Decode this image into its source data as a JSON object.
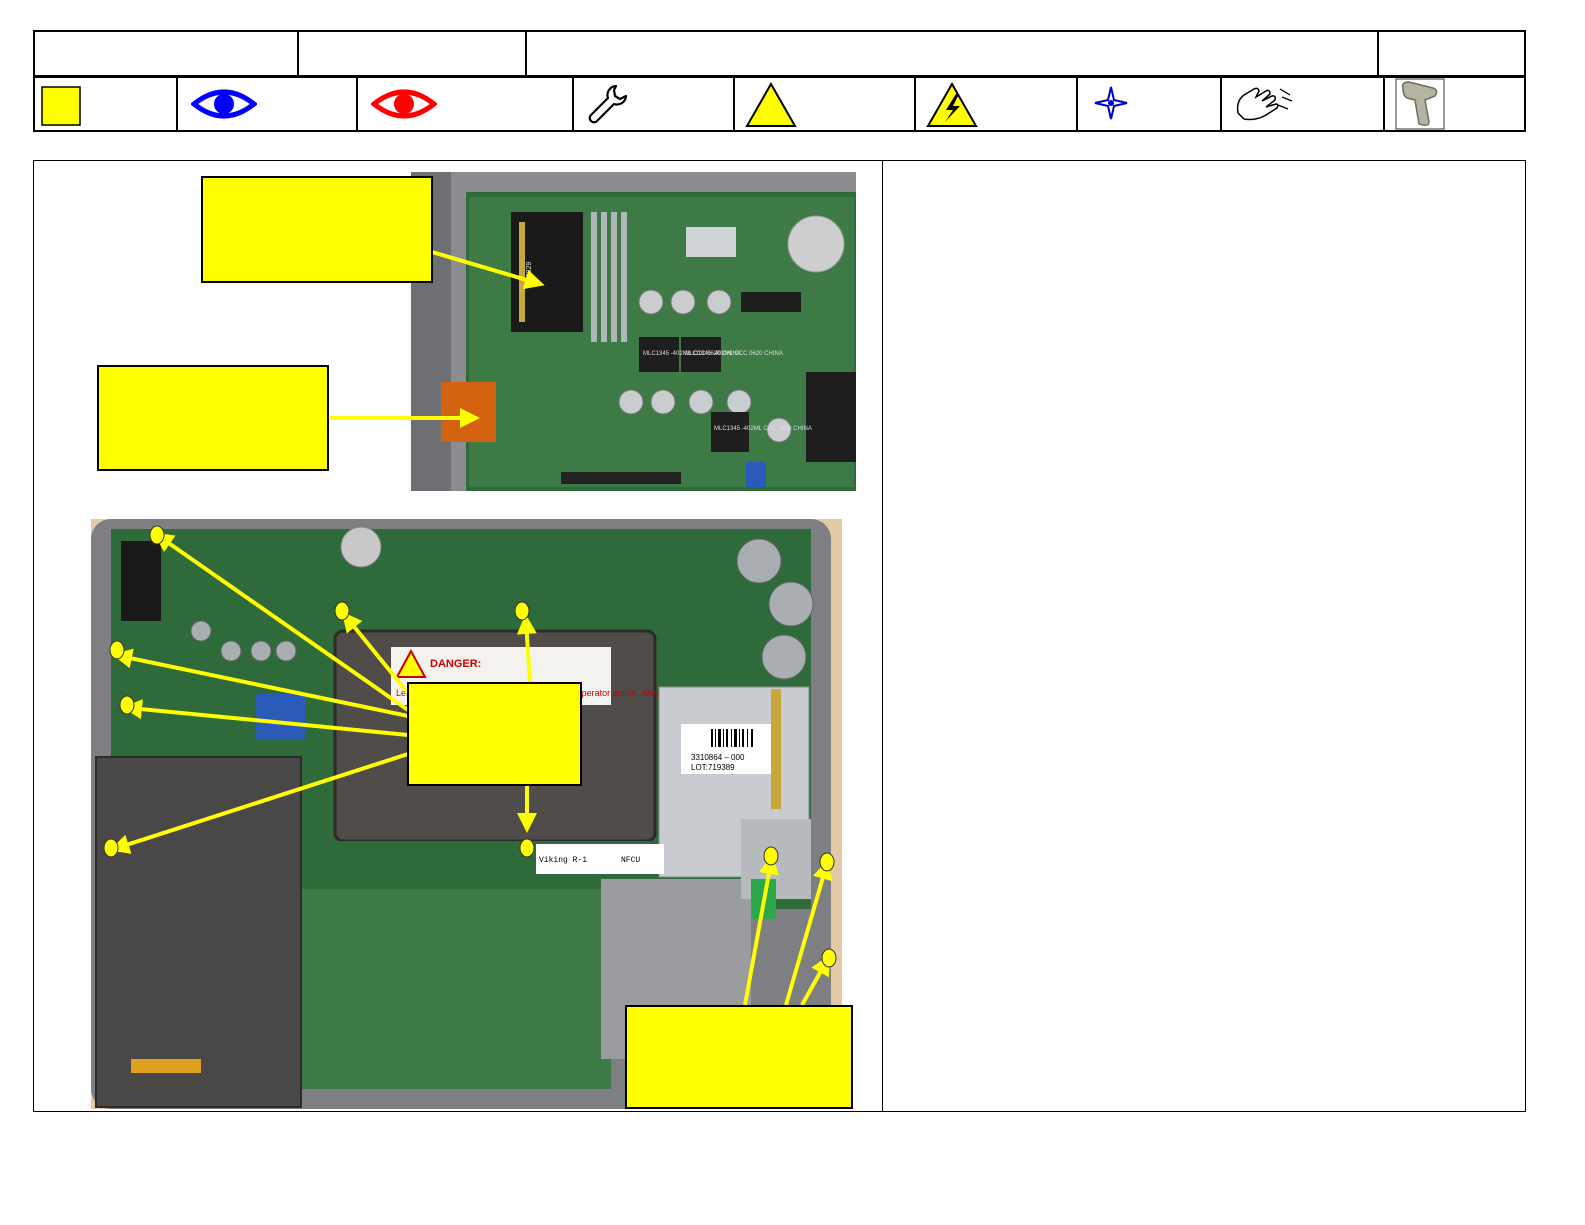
{
  "header": {
    "cells": [
      "",
      "",
      "",
      ""
    ],
    "icons": [
      {
        "name": "yellow-square-icon",
        "color": "#ffff00"
      },
      {
        "name": "blue-eye-icon",
        "color": "#0000ff"
      },
      {
        "name": "red-eye-icon",
        "color": "#ff0000"
      },
      {
        "name": "wrench-icon",
        "color": "#000000"
      },
      {
        "name": "caution-triangle-icon",
        "color": "#ffff00"
      },
      {
        "name": "electrical-hazard-icon",
        "color": "#ffff00"
      },
      {
        "name": "compass-star-icon",
        "color": "#0000cc"
      },
      {
        "name": "hand-wipe-icon",
        "color": "#000000"
      },
      {
        "name": "barcode-scanner-icon",
        "color": "#a0a08c"
      }
    ]
  },
  "photo_top": {
    "chip_labels": [
      "MLC1345 -402ML CCC 0620 CHINA",
      "MLC1345 -402ML CCC 0620 CHINA",
      "MLC1345 -402ML CCC 0620 CHINA"
    ],
    "connector_label": "P6329"
  },
  "photo_bottom": {
    "danger_title": "DANGER:",
    "danger_text": "Lethal voltages may be present even without operator action. Always",
    "part_number": "3310864 – 000",
    "lot": "LOT:719389",
    "sticker_1": "Viking R-1",
    "sticker_2": "NFCU"
  },
  "callouts": [
    "",
    "",
    "",
    ""
  ],
  "colors": {
    "callout": "#ffff00",
    "arrow": "#ffff00",
    "pcb": "#2f6b3a",
    "housing": "#7d7f82"
  }
}
